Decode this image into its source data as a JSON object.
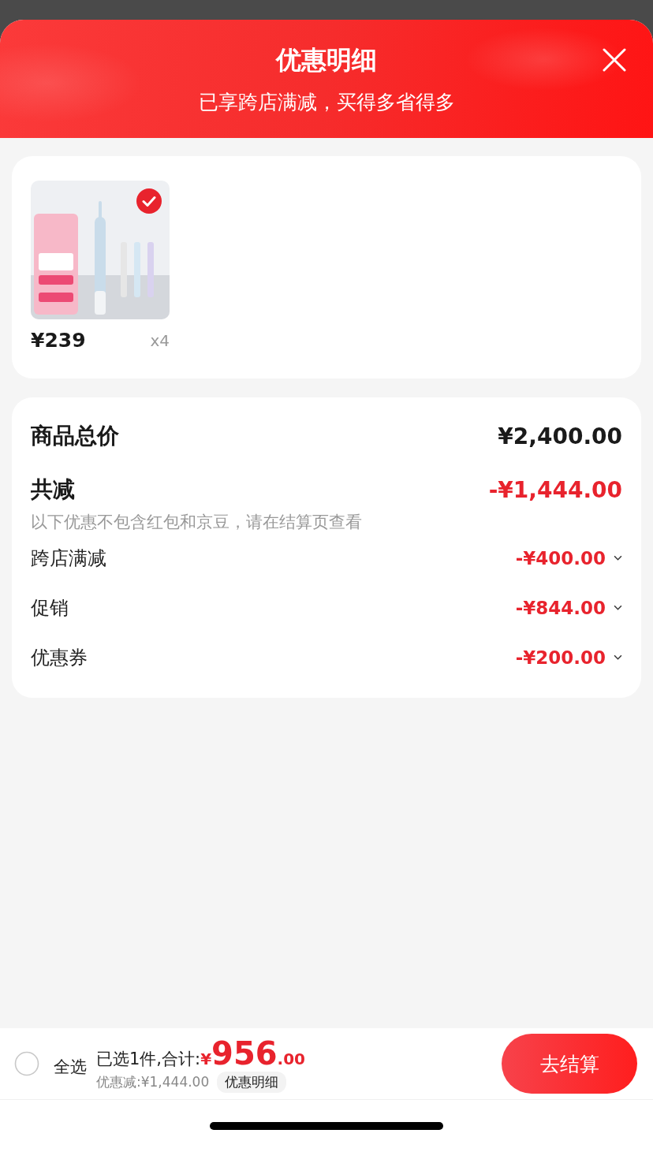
{
  "header": {
    "title": "优惠明细",
    "subtitle": "已享跨店满减，买得多省得多"
  },
  "products": [
    {
      "kind": "picture",
      "selected": true,
      "price": "¥239",
      "quantity": "x4"
    }
  ],
  "summary": {
    "total_label": "商品总价",
    "total_value": "¥2,400.00",
    "discount_label": "共减",
    "discount_value": "-¥1,444.00",
    "note": "以下优惠不包含红包和京豆，请在结算页查看",
    "items": [
      {
        "label": "跨店满减",
        "value": "-¥400.00",
        "expanded": false
      },
      {
        "label": "促销",
        "value": "-¥844.00",
        "expanded": false
      },
      {
        "label": "优惠券",
        "value": "-¥200.00",
        "expanded": false
      }
    ]
  },
  "footer": {
    "select_all": {
      "label": "全选",
      "checked": false
    },
    "selected_text": "已选1件,合计:",
    "currency": "¥",
    "amount_int": "956",
    "amount_dec": ".00",
    "discount_text": "优惠减:¥1,444.00",
    "detail_link": "优惠明细",
    "checkout": "去结算"
  }
}
